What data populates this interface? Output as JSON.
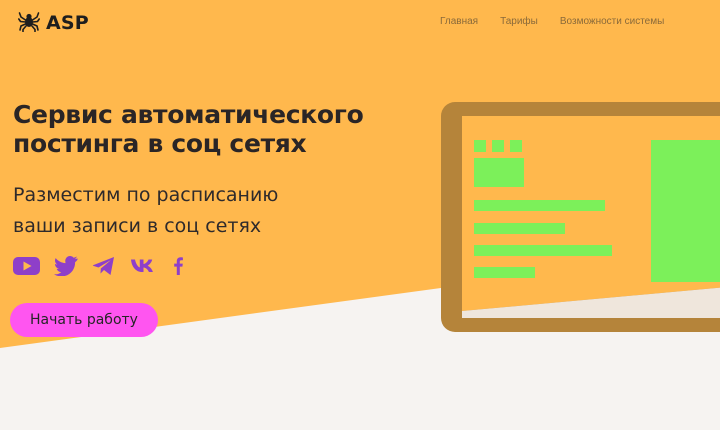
{
  "header": {
    "logo_text": "ASP",
    "logo_icon": "spider-icon",
    "nav": [
      "Главная",
      "Тарифы",
      "Возможности системы"
    ]
  },
  "hero": {
    "title_line1": "Сервис автоматического",
    "title_line2": "постинга в соц сетях",
    "subtitle_line1": "Разместим по расписанию",
    "subtitle_line2": "ваши записи в соц сетях",
    "socials": [
      "youtube-icon",
      "twitter-icon",
      "telegram-icon",
      "vk-icon",
      "facebook-icon"
    ],
    "cta_label": "Начать работу"
  },
  "colors": {
    "hero_bg": "#ffb84d",
    "page_bg": "#f6f3f1",
    "accent_pink": "#ff55f0",
    "icon_purple": "#8e3fc9",
    "mock_green": "#7cf05a",
    "mock_frame": "#b5843a"
  }
}
